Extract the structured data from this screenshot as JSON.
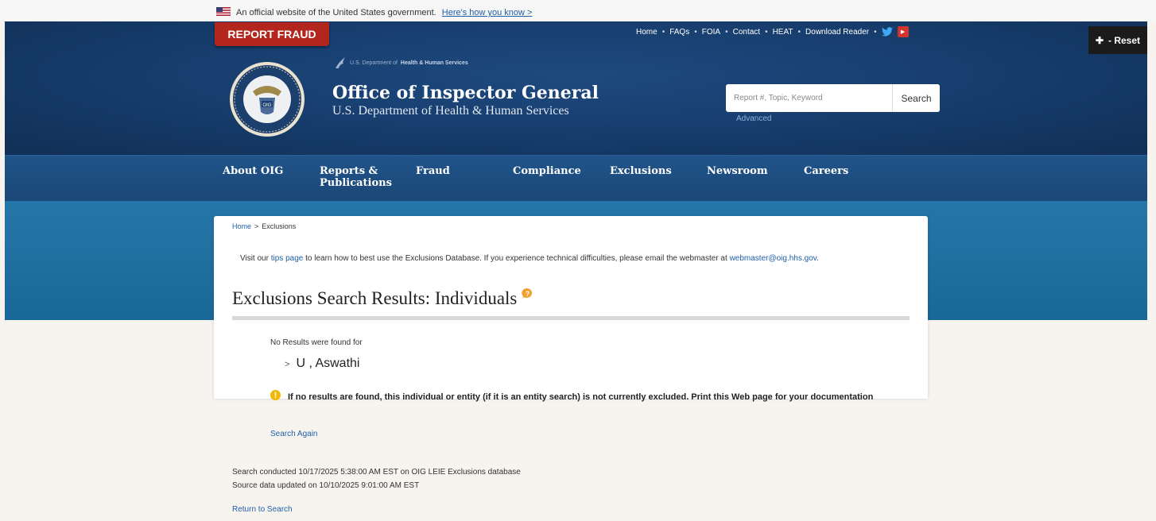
{
  "gov_banner": {
    "text": "An official website of the United States government.",
    "link": "Here's how you know >"
  },
  "header": {
    "report_fraud": "REPORT FRAUD",
    "utility_nav": [
      "Home",
      "FAQs",
      "FOIA",
      "Contact",
      "HEAT",
      "Download Reader"
    ],
    "reset_label": "- Reset",
    "dept_prefix": "U.S. Department of",
    "dept_name": "Health & Human Services",
    "title": "Office of Inspector General",
    "subtitle": "U.S. Department of Health & Human Services",
    "search_placeholder": "Report #, Topic, Keyword",
    "search_button": "Search",
    "advanced": "Advanced",
    "seal_text": "OIG"
  },
  "nav": {
    "about": "About OIG",
    "reports": "Reports &",
    "reports2": "Publications",
    "fraud": "Fraud",
    "compliance": "Compliance",
    "exclusions": "Exclusions",
    "newsroom": "Newsroom",
    "careers": "Careers"
  },
  "breadcrumb": {
    "home": "Home",
    "sep": ">",
    "current": "Exclusions"
  },
  "intro": {
    "pre": "Visit our",
    "tips_link": "tips page",
    "mid": "to learn how to best use the Exclusions Database. If you experience technical difficulties, please email the webmaster at",
    "email": "webmaster@oig.hhs.gov",
    "end": "."
  },
  "main": {
    "title": "Exclusions Search Results: Individuals",
    "no_results": "No Results were found for",
    "query": "U , Aswathi",
    "notice": "If no results are found, this individual or entity (if it is an entity search) is not currently excluded. Print this Web page for your documentation",
    "search_again": "Search Again",
    "search_conducted": "Search conducted 10/17/2025 5:38:00 AM EST on OIG LEIE Exclusions database",
    "source_updated": "Source data updated on 10/10/2025 9:01:00 AM EST",
    "return_to_search": "Return to Search"
  },
  "icons": {
    "flag": "us-flag-icon",
    "twitter": "twitter-icon",
    "youtube": "youtube-icon",
    "help": "help-bubble-icon",
    "warning": "warning-icon",
    "plus": "plus-icon"
  },
  "colors": {
    "header_blue": "#163c6b",
    "band_blue": "#1f6fa2",
    "fraud_red": "#b3261e",
    "link_blue": "#1f5fa8",
    "warning_yellow": "#f2b705",
    "help_orange": "#f0a030"
  }
}
